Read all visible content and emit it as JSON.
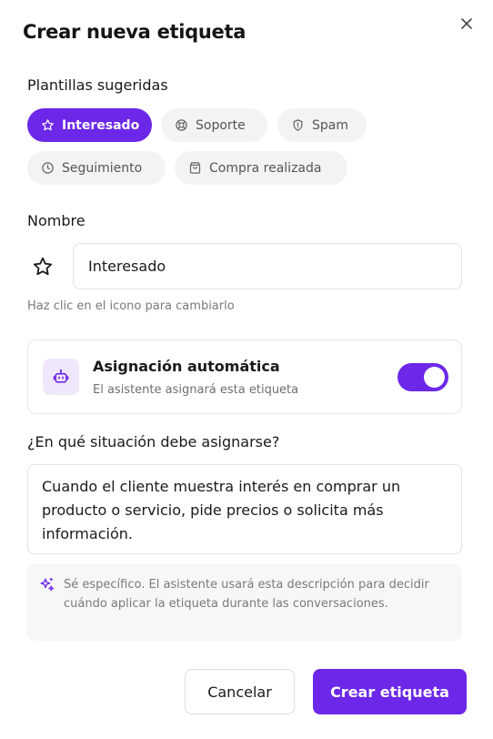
{
  "dialog": {
    "title": "Crear nueva etiqueta",
    "close_icon": "close-icon"
  },
  "templates": {
    "label": "Plantillas sugeridas",
    "items": [
      {
        "label": "Interesado",
        "icon": "star-icon",
        "selected": true
      },
      {
        "label": "Soporte",
        "icon": "lifebuoy-icon",
        "selected": false
      },
      {
        "label": "Spam",
        "icon": "shield-icon",
        "selected": false
      },
      {
        "label": "Seguimiento",
        "icon": "clock-icon",
        "selected": false
      },
      {
        "label": "Compra realizada",
        "icon": "shopping-bag-icon",
        "selected": false
      }
    ]
  },
  "name": {
    "label": "Nombre",
    "icon": "star-icon",
    "value": "Interesado",
    "hint": "Haz clic en el icono para cambiarlo"
  },
  "auto_assign": {
    "icon": "bot-icon",
    "title": "Asignación automática",
    "subtitle": "El asistente asignará esta etiqueta",
    "enabled": true
  },
  "situation": {
    "label": "¿En qué situación debe asignarse?",
    "value": "Cuando el cliente muestra interés en comprar un producto o servicio, pide precios o solicita más información.",
    "tip_icon": "sparkles-icon",
    "tip": "Sé específico. El asistente usará esta descripción para decidir cuándo aplicar la etiqueta durante las conversaciones."
  },
  "actions": {
    "cancel_label": "Cancelar",
    "create_label": "Crear etiqueta"
  },
  "colors": {
    "accent": "#6c27e8",
    "accent_soft": "#efe8fc",
    "chip_bg": "#f3f3f3"
  }
}
